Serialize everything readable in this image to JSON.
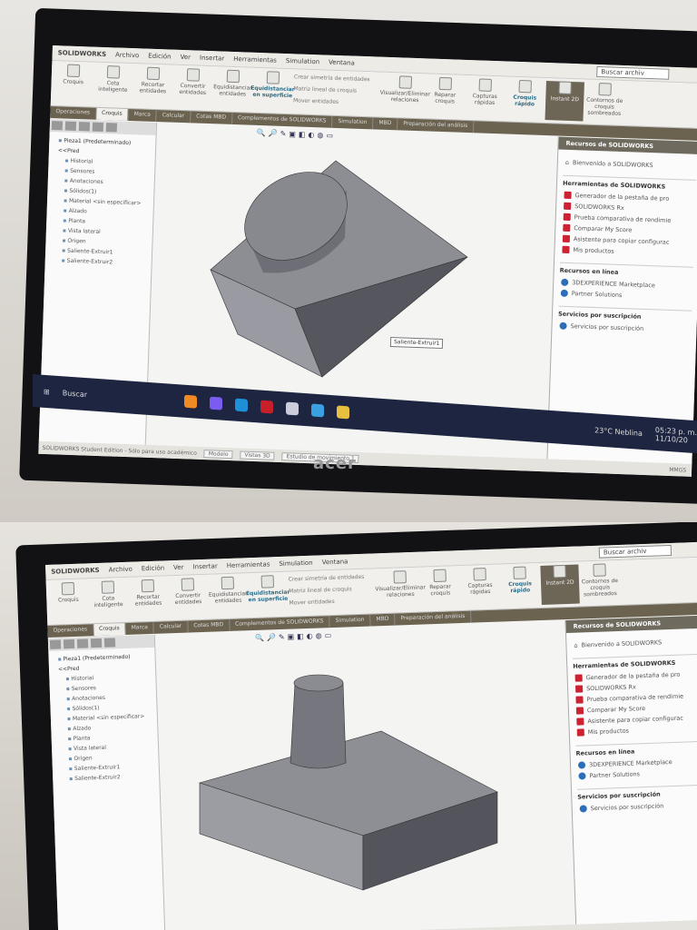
{
  "app": {
    "brand": "SOLIDWORKS",
    "menus": [
      "Archivo",
      "Edición",
      "Ver",
      "Insertar",
      "Herramientas",
      "Simulation",
      "Ventana"
    ],
    "search_placeholder": "Buscar archiv",
    "ribbon": [
      "Croquis",
      "Cota inteligente",
      "Recortar entidades",
      "Convertir entidades",
      "Equidistanciar entidades",
      "Equidistanciar en superficie"
    ],
    "ribbon_list": [
      "Crear simetría de entidades",
      "Matriz lineal de croquis",
      "Mover entidades"
    ],
    "ribbon_right": [
      "Visualizar/Eliminar relaciones",
      "Reparar croquis",
      "Capturas rápidas",
      "Croquis rápido",
      "Instant 2D",
      "Contornos de croquis sombreados"
    ],
    "tabs": [
      "Operaciones",
      "Croquis",
      "Marca",
      "Calcular",
      "Cotas MBD",
      "Complementos de SOLIDWORKS",
      "Simulation",
      "MBD",
      "Preparación del análisis"
    ],
    "active_tab": "Croquis",
    "tree": {
      "root": "Pieza1 (Predeterminado) <<Pred",
      "items": [
        "Historial",
        "Sensores",
        "Anotaciones",
        "Sólidos(1)",
        "Material <sin especificar>",
        "Alzado",
        "Planta",
        "Vista lateral",
        "Origen",
        "Saliente-Extruir1",
        "Saliente-Extruir2"
      ]
    },
    "taskpane": {
      "title": "Recursos de SOLIDWORKS",
      "welcome": "Bienvenido a SOLIDWORKS",
      "tools_header": "Herramientas de SOLIDWORKS",
      "tools": [
        "Generador de la pestaña de pro",
        "SOLIDWORKS Rx",
        "Prueba comparativa de rendimie",
        "Comparar My Score",
        "Asistente para copiar configurac",
        "Mis productos"
      ],
      "online_header": "Recursos en línea",
      "online": [
        "3DEXPERIENCE Marketplace",
        "Partner Solutions"
      ],
      "subs_header": "Servicios por suscripción",
      "subs": [
        "Servicios por suscripción"
      ]
    },
    "bottom_tabs": [
      "Modelo",
      "Vistas 3D",
      "Estudio de movimiento 1"
    ],
    "status": "SOLIDWORKS Student Edition - Sólo para uso académico",
    "units": "MMGS",
    "tooltip": "Saliente-Extruir1"
  },
  "taskbar": {
    "search": "Buscar",
    "weather": "23°C Neblina",
    "time": "05:23 p. m.",
    "date": "11/10/20"
  },
  "monitor": {
    "brand": "acer"
  }
}
